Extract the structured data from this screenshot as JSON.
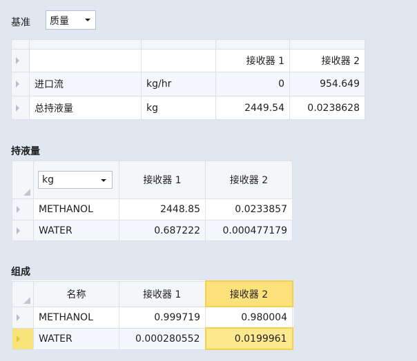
{
  "basis": {
    "label": "基准",
    "value": "质量"
  },
  "summary_table": {
    "columns": [
      "",
      "",
      "接收器 1",
      "接收器 2"
    ],
    "rows": [
      {
        "name": "进口流",
        "unit": "kg/hr",
        "values": [
          "0",
          "954.649"
        ]
      },
      {
        "name": "总持液量",
        "unit": "kg",
        "values": [
          "2449.54",
          "0.0238628"
        ]
      }
    ]
  },
  "holdup": {
    "title": "持液量",
    "unit_selector": "kg",
    "columns": [
      "接收器 1",
      "接收器 2"
    ],
    "rows": [
      {
        "name": "METHANOL",
        "values": [
          "2448.85",
          "0.0233857"
        ]
      },
      {
        "name": "WATER",
        "values": [
          "0.687222",
          "0.000477179"
        ]
      }
    ]
  },
  "composition": {
    "title": "组成",
    "name_header": "名称",
    "columns": [
      "接收器 1",
      "接收器 2"
    ],
    "rows": [
      {
        "name": "METHANOL",
        "values": [
          "0.999719",
          "0.980004"
        ]
      },
      {
        "name": "WATER",
        "values": [
          "0.000280552",
          "0.0199961"
        ]
      }
    ],
    "selected_column": "接收器 2",
    "selection_color": "#fde98e"
  }
}
